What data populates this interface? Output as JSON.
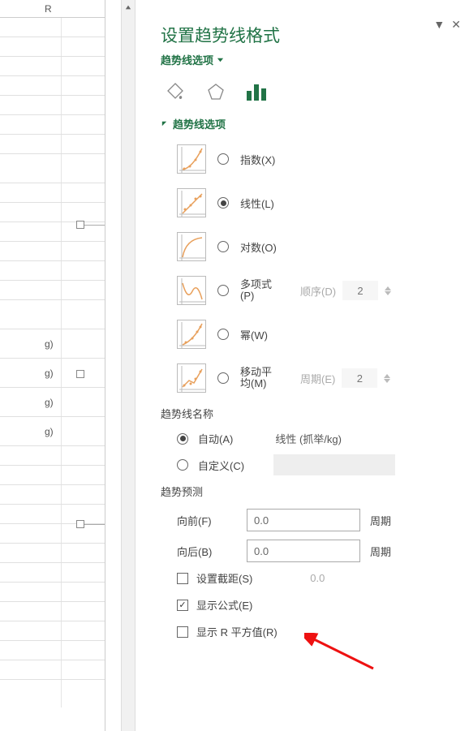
{
  "column_header": "R",
  "cell_labels": [
    "g)",
    "g)",
    "g)",
    "g)"
  ],
  "panel": {
    "title": "设置趋势线格式",
    "subtitle": "趋势线选项",
    "section": "趋势线选项"
  },
  "options": {
    "exp": "指数(X)",
    "lin": "线性(L)",
    "log": "对数(O)",
    "poly": "多项式(P)",
    "poly_order_label": "顺序(D)",
    "poly_order_value": "2",
    "pow": "幂(W)",
    "ma": "移动平均(M)",
    "ma_period_label": "周期(E)",
    "ma_period_value": "2"
  },
  "line_name": {
    "label": "趋势线名称",
    "auto": "自动(A)",
    "auto_value": "线性 (抓举/kg)",
    "custom": "自定义(C)"
  },
  "forecast": {
    "label": "趋势预测",
    "fwd_label": "向前(F)",
    "fwd_value": "0.0",
    "bwd_label": "向后(B)",
    "bwd_value": "0.0",
    "unit": "周期"
  },
  "checks": {
    "intercept_label": "设置截距(S)",
    "intercept_value": "0.0",
    "eq_label": "显示公式(E)",
    "r2_label": "显示 R 平方值(R)"
  }
}
